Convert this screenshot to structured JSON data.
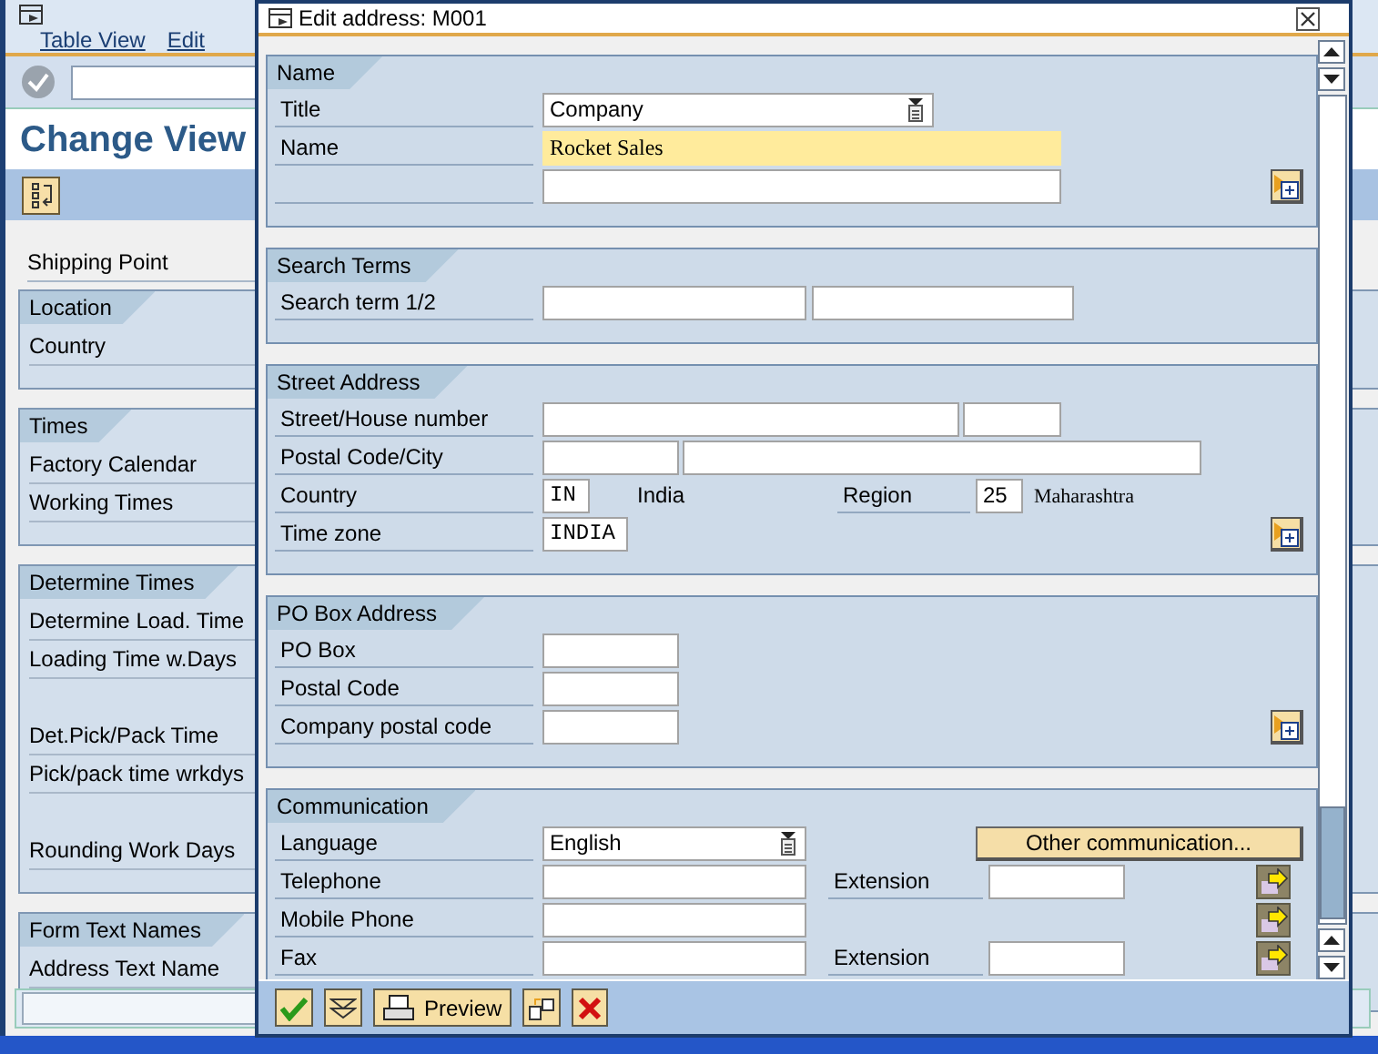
{
  "app": {
    "menu": [
      {
        "label": "Table View"
      },
      {
        "label": "Edit"
      }
    ],
    "title": "Change View",
    "groups": [
      {
        "rows": [
          {
            "kind": "label",
            "label": "Shipping Point"
          }
        ]
      },
      {
        "title": "Location",
        "rows": [
          {
            "kind": "label",
            "label": "Country"
          }
        ]
      },
      {
        "title": "Times",
        "rows": [
          {
            "kind": "label",
            "label": "Factory Calendar"
          },
          {
            "kind": "label",
            "label": "Working Times"
          }
        ]
      },
      {
        "title": "Determine Times",
        "rows": [
          {
            "kind": "label",
            "label": "Determine Load. Time"
          },
          {
            "kind": "label",
            "label": "Loading Time w.Days"
          },
          {
            "kind": "blank"
          },
          {
            "kind": "label",
            "label": "Det.Pick/Pack Time"
          },
          {
            "kind": "label",
            "label": "Pick/pack time wrkdys"
          },
          {
            "kind": "blank"
          },
          {
            "kind": "label",
            "label": "Rounding Work Days"
          }
        ]
      },
      {
        "title": "Form Text Names",
        "rows": [
          {
            "kind": "label",
            "label": "Address Text Name"
          }
        ]
      }
    ]
  },
  "dialog": {
    "title": "Edit address:  M001",
    "sections": [
      {
        "title": "Name",
        "rows": [
          {
            "items": [
              {
                "kind": "label",
                "text": "Title"
              },
              {
                "kind": "dropdown",
                "value": "Company"
              }
            ]
          },
          {
            "items": [
              {
                "kind": "label",
                "text": "Name"
              },
              {
                "kind": "highlighted_field",
                "value": "Rocket Sales"
              }
            ]
          },
          {
            "items": [
              {
                "kind": "label"
              },
              {
                "kind": "field"
              },
              {
                "kind": "expand_button"
              }
            ]
          }
        ]
      },
      {
        "title": "Search Terms",
        "rows": [
          {
            "items": [
              {
                "kind": "label",
                "text": "Search term 1/2"
              },
              {
                "kind": "field"
              },
              {
                "kind": "field"
              }
            ]
          }
        ]
      },
      {
        "title": "Street Address",
        "rows": [
          {
            "items": [
              {
                "kind": "label",
                "text": "Street/House number"
              },
              {
                "kind": "field"
              },
              {
                "kind": "field"
              }
            ]
          },
          {
            "items": [
              {
                "kind": "label",
                "text": "Postal Code/City"
              },
              {
                "kind": "field"
              },
              {
                "kind": "field"
              }
            ]
          },
          {
            "items": [
              {
                "kind": "label",
                "text": "Country"
              },
              {
                "kind": "code_field",
                "value": "IN"
              },
              {
                "kind": "text",
                "text": "India"
              },
              {
                "kind": "label",
                "text": "Region"
              },
              {
                "kind": "field",
                "value": "25"
              },
              {
                "kind": "description",
                "text": "Maharashtra"
              }
            ]
          },
          {
            "items": [
              {
                "kind": "label",
                "text": "Time zone"
              },
              {
                "kind": "code_field",
                "value": "INDIA"
              },
              {
                "kind": "expand_button"
              }
            ]
          }
        ]
      },
      {
        "title": "PO Box Address",
        "rows": [
          {
            "items": [
              {
                "kind": "label",
                "text": "PO Box"
              },
              {
                "kind": "field"
              }
            ]
          },
          {
            "items": [
              {
                "kind": "label",
                "text": "Postal Code"
              },
              {
                "kind": "field"
              }
            ]
          },
          {
            "items": [
              {
                "kind": "label",
                "text": "Company postal code"
              },
              {
                "kind": "field"
              },
              {
                "kind": "expand_button"
              }
            ]
          }
        ]
      },
      {
        "title": "Communication",
        "rows": [
          {
            "items": [
              {
                "kind": "label",
                "text": "Language"
              },
              {
                "kind": "dropdown",
                "value": "English"
              },
              {
                "kind": "button",
                "text": "Other communication..."
              }
            ]
          },
          {
            "items": [
              {
                "kind": "label",
                "text": "Telephone"
              },
              {
                "kind": "field"
              },
              {
                "kind": "label",
                "text": "Extension"
              },
              {
                "kind": "field"
              },
              {
                "kind": "arrow_button"
              }
            ]
          },
          {
            "items": [
              {
                "kind": "label",
                "text": "Mobile Phone"
              },
              {
                "kind": "field"
              },
              {
                "kind": "arrow_button"
              }
            ]
          },
          {
            "items": [
              {
                "kind": "label",
                "text": "Fax"
              },
              {
                "kind": "field"
              },
              {
                "kind": "label",
                "text": "Extension"
              },
              {
                "kind": "field"
              },
              {
                "kind": "arrow_button"
              }
            ]
          }
        ]
      }
    ],
    "toolbar": [
      {
        "kind": "confirm"
      },
      {
        "kind": "expand"
      },
      {
        "kind": "print",
        "label": "Preview"
      },
      {
        "kind": "options"
      },
      {
        "kind": "cancel"
      }
    ]
  }
}
